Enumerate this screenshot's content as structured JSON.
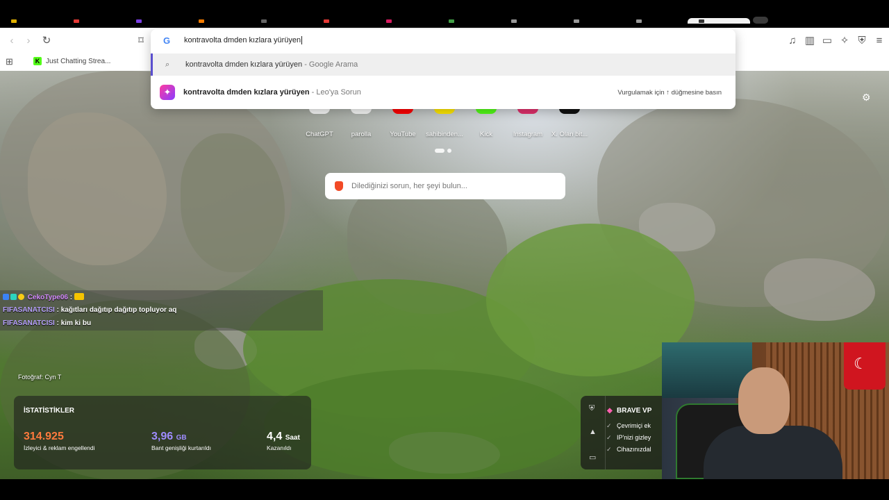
{
  "omnibox": {
    "query": "kontravolta dmden kızlara yürüyen",
    "suggestion_google_text": "kontravolta dmden kızlara yürüyen",
    "suggestion_google_suffix": " - Google Arama",
    "suggestion_leo_text": "kontravolta dmden kızlara yürüyen",
    "suggestion_leo_suffix": " - Leo'ya Sorun",
    "suggestion_leo_hint": "Vurgulamak için ↑ düğmesine basın"
  },
  "bookmarks": {
    "item1": "Just Chatting Strea..."
  },
  "shortcuts": [
    {
      "label": "ChatGPT",
      "color": "#ffffff"
    },
    {
      "label": "parolla",
      "color": "#ffffff"
    },
    {
      "label": "YouTube",
      "color": "#ff0000"
    },
    {
      "label": "sahibinden...",
      "color": "#ffe800"
    },
    {
      "label": "Kick",
      "color": "#53fc18"
    },
    {
      "label": "Instagram",
      "color": "#e1306c"
    },
    {
      "label": "X. Olan bit...",
      "color": "#000000"
    }
  ],
  "search": {
    "placeholder": "Dilediğinizi sorun, her şeyi bulun..."
  },
  "chat": [
    {
      "user": "CekoType06",
      "sep": " : ",
      "text": ""
    },
    {
      "user": "FIFASANATCISI",
      "sep": " : ",
      "text": "kağıtları dağıtıp dağıtıp topluyor aq"
    },
    {
      "user": "FIFASANATCISI",
      "sep": " : ",
      "text": "kim ki bu"
    }
  ],
  "photo_credit": "Fotoğraf: Cyn T",
  "stats": {
    "title": "İSTATİSTİKLER",
    "ads_value": "314.925",
    "ads_desc": "İzleyici & reklam engellendi",
    "bandwidth_value": "3,96",
    "bandwidth_unit": "GB",
    "bandwidth_desc": "Bant genişliği kurtarıldı",
    "time_value": "4,4",
    "time_unit": "Saat",
    "time_desc": "Kazanıldı"
  },
  "vpn": {
    "title": "BRAVE VP",
    "items": [
      "Çevrimiçi ek",
      "IP'nizi gizley",
      "Cihazınızdal"
    ]
  },
  "colors": {
    "ads": "#ff7a3d",
    "bandwidth": "#9f8cff",
    "time": "#ffffff",
    "accent": "#5a4fcf"
  }
}
